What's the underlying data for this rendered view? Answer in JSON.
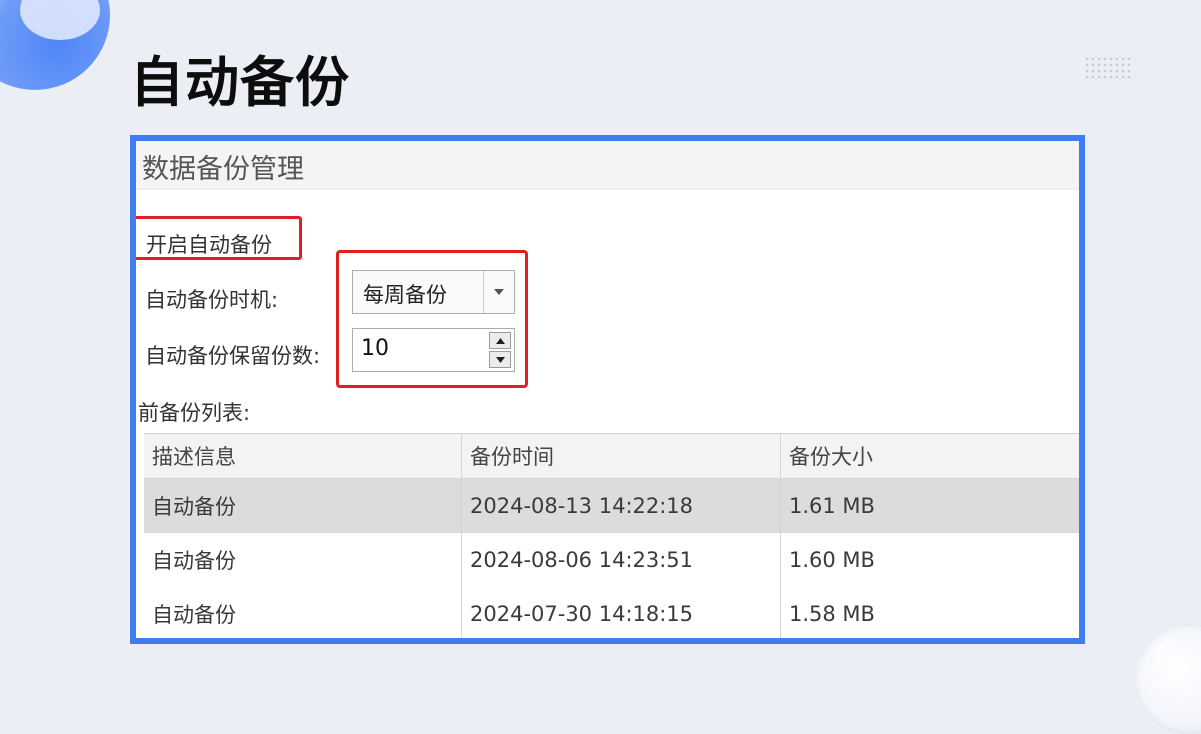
{
  "slide": {
    "title": "自动备份",
    "accent_color": "#3f7ef0",
    "highlight_color": "#e21e24"
  },
  "dialog": {
    "title": "数据备份管理",
    "enable_auto_backup_label": "开启自动备份",
    "timing_label": "自动备份时机:",
    "timing_value": "每周备份",
    "keep_count_label": "自动备份保留份数:",
    "keep_count_value": "10",
    "list_label": "前备份列表:",
    "table": {
      "columns": [
        "描述信息",
        "备份时间",
        "备份大小"
      ],
      "rows": [
        {
          "description": "自动备份",
          "time": "2024-08-13 14:22:18",
          "size": "1.61 MB",
          "selected": true
        },
        {
          "description": "自动备份",
          "time": "2024-08-06 14:23:51",
          "size": "1.60 MB",
          "selected": false
        },
        {
          "description": "自动备份",
          "time": "2024-07-30 14:18:15",
          "size": "1.58 MB",
          "selected": false
        }
      ]
    }
  }
}
